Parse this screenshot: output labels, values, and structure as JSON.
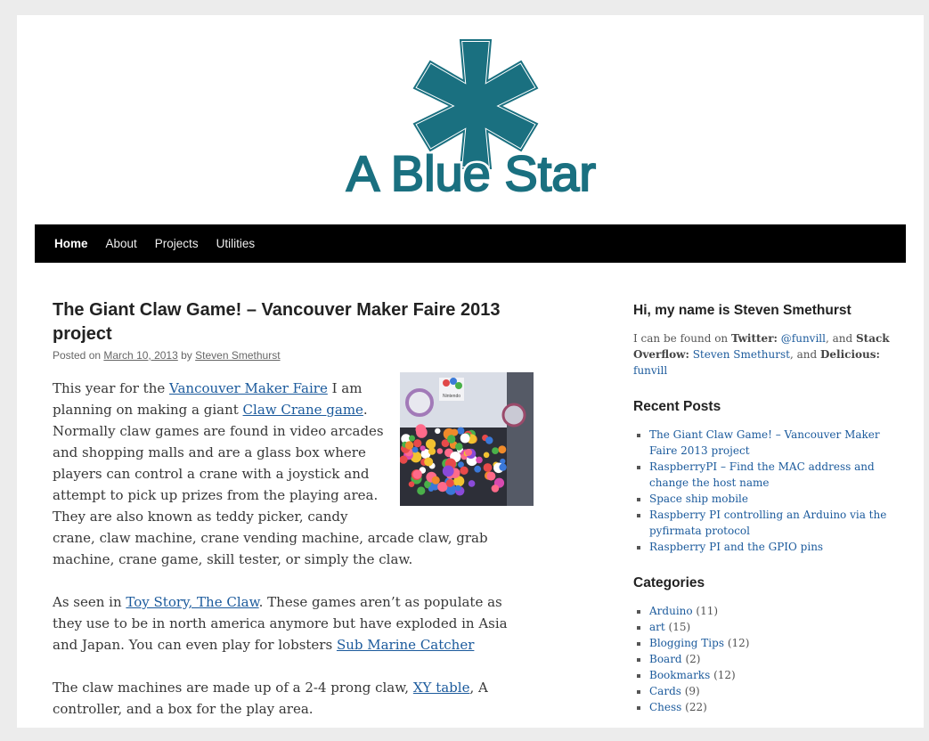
{
  "site": {
    "logo_text": "A Blue Star",
    "logo_color": "#1a7080"
  },
  "nav": {
    "items": [
      {
        "label": "Home",
        "current": true
      },
      {
        "label": "About"
      },
      {
        "label": "Projects"
      },
      {
        "label": "Utilities"
      }
    ]
  },
  "post": {
    "title": "The Giant Claw Game! – Vancouver Maker Faire 2013 project",
    "meta": {
      "posted_on": "Posted on",
      "date": "March 10, 2013",
      "by": "by",
      "author": "Steven Smethurst"
    },
    "p1": {
      "t1": "This year for the ",
      "link1": "Vancouver Maker Faire",
      "t2": " I am planning on making a giant ",
      "link2": "Claw Crane game",
      "t3": ".  Normally claw games are found in video arcades and shopping malls and are a glass box where players can control a crane with a joystick and attempt to pick up prizes from the playing area. They are also known as teddy picker, candy crane, claw machine, crane vending machine, arcade claw, grab machine, crane game, skill tester, or simply the claw."
    },
    "p2": {
      "t1": "As seen in ",
      "link1": "Toy Story, The Claw",
      "t2": ". These games aren’t as populate as they use to be in north america anymore but have exploded in Asia and Japan. You can even play for lobsters ",
      "link2": "Sub Marine Catcher"
    },
    "p3": {
      "t1": "The claw machines are made up of a 2-4 prong claw, ",
      "link1": "XY table",
      "t2": ", A controller, and a box for the play area."
    },
    "image_sign": "Nintendo"
  },
  "sidebar": {
    "about": {
      "title": "Hi, my name is Steven Smethurst",
      "t1": "I can be found on ",
      "twitter_label": "Twitter:",
      "twitter_handle": "@funvill",
      "t2": ", and ",
      "so_label": "Stack Overflow:",
      "so_name": "Steven Smethurst",
      "t3": ", and ",
      "delicious_label": "Delicious:",
      "delicious_name": "funvill"
    },
    "recent": {
      "title": "Recent Posts",
      "items": [
        "The Giant Claw Game! – Vancouver Maker Faire 2013 project",
        "RaspberryPI – Find the MAC address and change the host name",
        "Space ship mobile",
        "Raspberry PI controlling an Arduino via the pyfirmata protocol",
        "Raspberry PI and the GPIO pins"
      ]
    },
    "categories": {
      "title": "Categories",
      "items": [
        {
          "name": "Arduino",
          "count": " (11)"
        },
        {
          "name": "art",
          "count": " (15)"
        },
        {
          "name": "Blogging Tips",
          "count": " (12)"
        },
        {
          "name": "Board",
          "count": " (2)"
        },
        {
          "name": "Bookmarks",
          "count": " (12)"
        },
        {
          "name": "Cards",
          "count": " (9)"
        },
        {
          "name": "Chess",
          "count": " (22)"
        }
      ]
    }
  }
}
